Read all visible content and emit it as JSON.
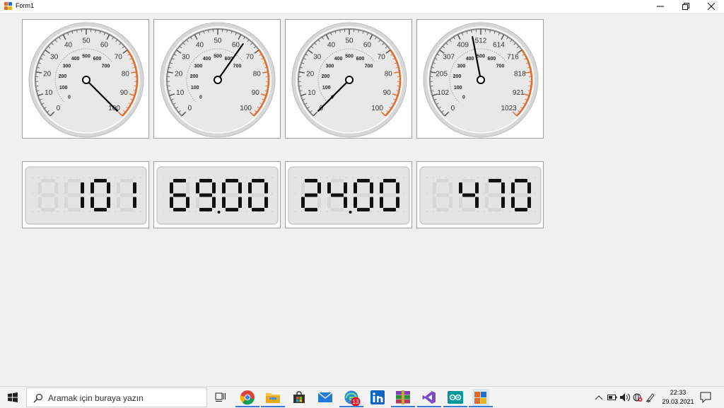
{
  "window": {
    "title": "Form1"
  },
  "gauges": [
    {
      "name": "gauge-1",
      "outer_ticks": [
        "0",
        "10",
        "20",
        "30",
        "40",
        "50",
        "60",
        "70",
        "80",
        "90",
        "100"
      ],
      "inner_ticks": [
        "0",
        "100",
        "200",
        "300",
        "400",
        "500",
        "600",
        "700"
      ],
      "needle_value": 100
    },
    {
      "name": "gauge-2",
      "outer_ticks": [
        "0",
        "10",
        "20",
        "30",
        "40",
        "50",
        "60",
        "70",
        "80",
        "90",
        "100"
      ],
      "inner_ticks": [
        "0",
        "100",
        "200",
        "300",
        "400",
        "500",
        "600",
        "700"
      ],
      "needle_value": 63
    },
    {
      "name": "gauge-3",
      "outer_ticks": [
        "0",
        "10",
        "20",
        "30",
        "40",
        "50",
        "60",
        "70",
        "80",
        "90",
        "100"
      ],
      "inner_ticks": [
        "0",
        "100",
        "200",
        "300",
        "400",
        "500",
        "600",
        "700"
      ],
      "needle_value": 0
    },
    {
      "name": "gauge-4",
      "outer_ticks": [
        "0",
        "102",
        "205",
        "307",
        "409",
        "512",
        "614",
        "716",
        "818",
        "921",
        "1023"
      ],
      "inner_ticks": [
        "0",
        "100",
        "200",
        "300",
        "400",
        "500",
        "600",
        "700"
      ],
      "needle_value": 470
    }
  ],
  "displays": [
    {
      "name": "display-1",
      "digits": [
        "",
        "1",
        "0",
        "1"
      ],
      "decimal_after": -1
    },
    {
      "name": "display-2",
      "digits": [
        "6",
        "9",
        "0",
        "0"
      ],
      "decimal_after": 1
    },
    {
      "name": "display-3",
      "digits": [
        "2",
        "4",
        "0",
        "0"
      ],
      "decimal_after": 1
    },
    {
      "name": "display-4",
      "digits": [
        "",
        "4",
        "7",
        "0"
      ],
      "decimal_after": -1
    }
  ],
  "taskbar": {
    "search_placeholder": "Aramak için buraya yazın",
    "badge_count": "13",
    "time": "22:33",
    "date": "29.03.2021",
    "apps": [
      "task-view",
      "chrome",
      "file-explorer",
      "store",
      "mail",
      "edge",
      "linkedin",
      "winrar",
      "visual-studio",
      "arduino",
      "form1-app"
    ]
  },
  "colors": {
    "accent": "#e46a2b",
    "needle": "#000000",
    "segment_on": "#111111",
    "segment_off": "#d6d6d6"
  }
}
